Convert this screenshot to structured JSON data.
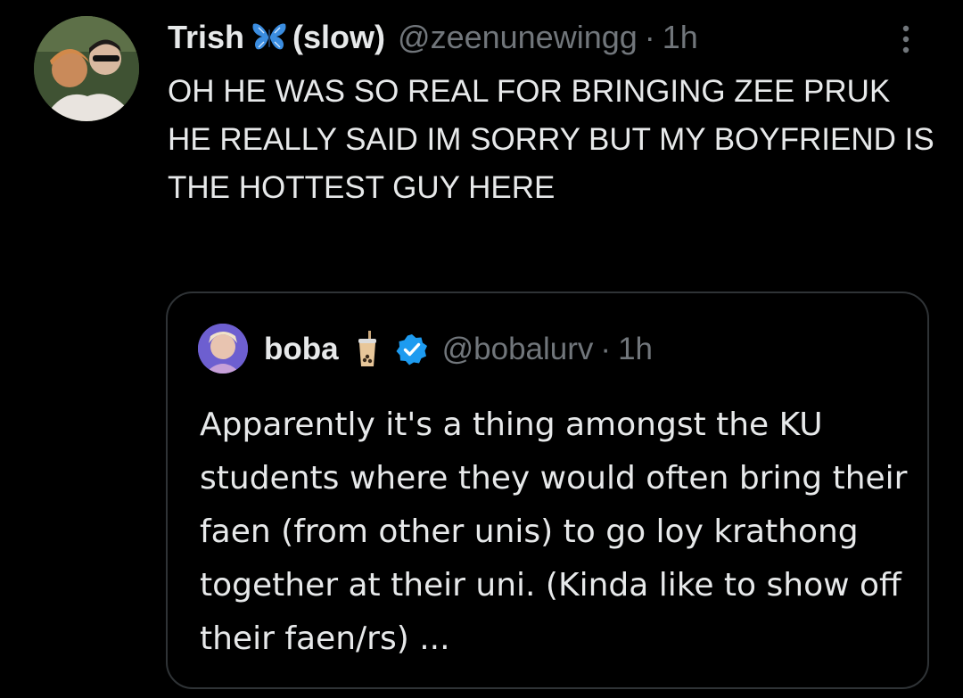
{
  "tweet": {
    "display_name": "Trish",
    "name_suffix": "(slow)",
    "handle": "@zeenunewingg",
    "separator": "·",
    "time": "1h",
    "text": "OH HE WAS SO REAL FOR BRINGING ZEE PRUK HE REALLY SAID IM SORRY BUT MY BOYFRIEND IS THE HOTTEST GUY HERE",
    "name_icon": "butterfly-icon"
  },
  "quoted_tweet": {
    "display_name": "boba",
    "name_icon": "bubble-tea-icon",
    "verified_icon": "verified-badge-icon",
    "handle": "@bobalurv",
    "separator": "·",
    "time": "1h",
    "text": "Apparently it's a thing amongst the KU students where they would often bring their faen (from other unis) to go loy krathong together at their uni. (Kinda like to show off their faen/rs) ..."
  },
  "colors": {
    "background": "#000000",
    "primary_text": "#e7e9ea",
    "secondary_text": "#71767b",
    "border": "#2f3336",
    "verified_blue": "#1d9bf0",
    "butterfly_blue": "#3b8de0"
  }
}
